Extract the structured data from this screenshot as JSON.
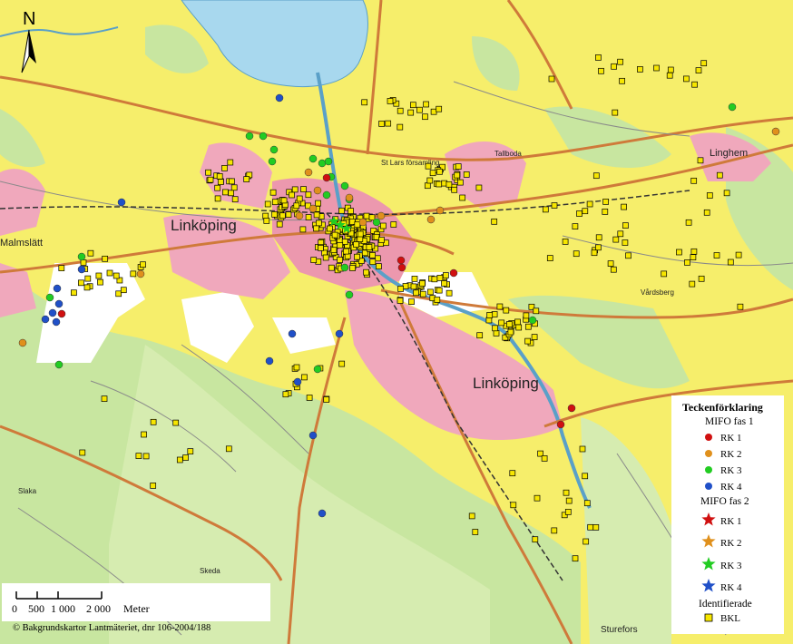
{
  "map": {
    "north_label": "N",
    "places": {
      "linkoping_main": "Linköping",
      "linkoping_south": "Linköping",
      "malmslatt": "Malmslätt",
      "lingehem": "Linghem",
      "sturefors": "Sturefors",
      "vardsberg": "Vårdsberg",
      "skeda": "Skeda",
      "tallboda": "Tallboda",
      "slaka": "Slaka",
      "stlars": "St Lars församling"
    },
    "land_color": "#f6ee6b",
    "water_color": "#a8d8ee",
    "urban_color": "#f0a8bc",
    "forest_color": "#c8e6a0",
    "road_color": "#cf7a3a"
  },
  "legend": {
    "title": "Teckenförklaring",
    "group1_title": "MIFO fas 1",
    "group1_items": [
      "RK 1",
      "RK 2",
      "RK 3",
      "RK 4"
    ],
    "group2_title": "MIFO fas 2",
    "group2_items": [
      "RK 1",
      "RK 2",
      "RK 3",
      "RK 4"
    ],
    "group3_title": "Identifierade",
    "group3_item": "BKL",
    "colors": {
      "rk1": "#d01010",
      "rk2": "#e0901c",
      "rk3": "#22cc22",
      "rk4": "#2050c8",
      "bkl": "#f7e600"
    }
  },
  "scale_bar": {
    "labels": [
      "0",
      "500",
      "1 000",
      "2 000"
    ],
    "unit": "Meter"
  },
  "credit": "© Bakgrundskartor Lantmäteriet, dnr 106-2004/188"
}
